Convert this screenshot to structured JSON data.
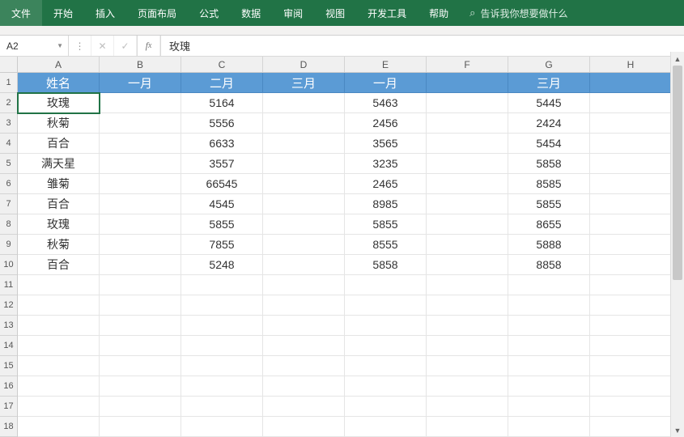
{
  "ribbon": {
    "tabs": [
      "文件",
      "开始",
      "插入",
      "页面布局",
      "公式",
      "数据",
      "审阅",
      "视图",
      "开发工具",
      "帮助"
    ],
    "search_placeholder": "告诉我你想要做什么"
  },
  "formula_bar": {
    "name_box": "A2",
    "formula_value": "玫瑰"
  },
  "grid": {
    "columns": [
      "A",
      "B",
      "C",
      "D",
      "E",
      "F",
      "G",
      "H"
    ],
    "row_count": 18,
    "active_cell": "A2",
    "header_row_index": 0,
    "header_fill": "#5b9bd5",
    "rows": [
      [
        "姓名",
        "一月",
        "二月",
        "三月",
        "一月",
        "",
        "三月",
        ""
      ],
      [
        "玫瑰",
        "",
        "5164",
        "",
        "5463",
        "",
        "5445",
        ""
      ],
      [
        "秋菊",
        "",
        "5556",
        "",
        "2456",
        "",
        "2424",
        ""
      ],
      [
        "百合",
        "",
        "6633",
        "",
        "3565",
        "",
        "5454",
        ""
      ],
      [
        "满天星",
        "",
        "3557",
        "",
        "3235",
        "",
        "5858",
        ""
      ],
      [
        "雏菊",
        "",
        "66545",
        "",
        "2465",
        "",
        "8585",
        ""
      ],
      [
        "百合",
        "",
        "4545",
        "",
        "8985",
        "",
        "5855",
        ""
      ],
      [
        "玫瑰",
        "",
        "5855",
        "",
        "5855",
        "",
        "8655",
        ""
      ],
      [
        "秋菊",
        "",
        "7855",
        "",
        "8555",
        "",
        "5888",
        ""
      ],
      [
        "百合",
        "",
        "5248",
        "",
        "5858",
        "",
        "8858",
        ""
      ],
      [
        "",
        "",
        "",
        "",
        "",
        "",
        "",
        ""
      ],
      [
        "",
        "",
        "",
        "",
        "",
        "",
        "",
        ""
      ],
      [
        "",
        "",
        "",
        "",
        "",
        "",
        "",
        ""
      ],
      [
        "",
        "",
        "",
        "",
        "",
        "",
        "",
        ""
      ],
      [
        "",
        "",
        "",
        "",
        "",
        "",
        "",
        ""
      ],
      [
        "",
        "",
        "",
        "",
        "",
        "",
        "",
        ""
      ],
      [
        "",
        "",
        "",
        "",
        "",
        "",
        "",
        ""
      ],
      [
        "",
        "",
        "",
        "",
        "",
        "",
        "",
        ""
      ]
    ]
  }
}
